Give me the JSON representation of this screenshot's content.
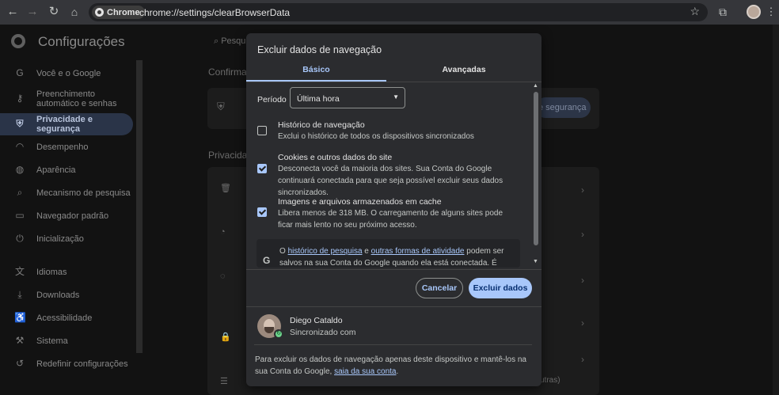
{
  "browser": {
    "chip_label": "Chrome",
    "url": "chrome://settings/clearBrowserData"
  },
  "settings": {
    "title": "Configurações",
    "search_placeholder": "Pesqu",
    "nav": [
      {
        "label": "Você e o Google",
        "icon": "google-icon"
      },
      {
        "label": "Preenchimento automático e senhas",
        "icon": "key-icon"
      },
      {
        "label": "Privacidade e segurança",
        "icon": "shield-icon",
        "active": true
      },
      {
        "label": "Desempenho",
        "icon": "gauge-icon"
      },
      {
        "label": "Aparência",
        "icon": "palette-icon"
      },
      {
        "label": "Mecanismo de pesquisa",
        "icon": "search-icon"
      },
      {
        "label": "Navegador padrão",
        "icon": "browser-icon"
      },
      {
        "label": "Inicialização",
        "icon": "power-icon"
      },
      {
        "label": "Idiomas",
        "icon": "translate-icon"
      },
      {
        "label": "Downloads",
        "icon": "download-icon"
      },
      {
        "label": "Acessibilidade",
        "icon": "accessibility-icon"
      },
      {
        "label": "Sistema",
        "icon": "wrench-icon"
      },
      {
        "label": "Redefinir configurações",
        "icon": "reset-icon"
      }
    ],
    "bg_section1": "Confirma",
    "bg_section2": "Privacida",
    "bg_button": "e segurança",
    "bg_truncated": "utras)"
  },
  "dialog": {
    "title": "Excluir dados de navegação",
    "tabs": [
      "Básico",
      "Avançadas"
    ],
    "period_label": "Período",
    "period_value": "Última hora",
    "options": [
      {
        "title": "Histórico de navegação",
        "desc": "Exclui o histórico de todos os dispositivos sincronizados",
        "checked": false
      },
      {
        "title": "Cookies e outros dados do site",
        "desc": "Desconecta você da maioria dos sites. Sua Conta do Google continuará conectada para que seja possível excluir seus dados sincronizados.",
        "checked": true
      },
      {
        "title": "Imagens e arquivos armazenados em cache",
        "desc": "Libera menos de 318 MB. O carregamento de alguns sites pode ficar mais lento no seu próximo acesso.",
        "checked": true
      }
    ],
    "info": {
      "prefix": "O ",
      "link1": "histórico de pesquisa",
      "middle": " e ",
      "link2": "outras formas de atividade",
      "suffix": " podem ser salvos na sua Conta do Google quando ela está conectada. É possível excluí-"
    },
    "cancel_label": "Cancelar",
    "delete_label": "Excluir dados",
    "user": {
      "name": "Diego Cataldo",
      "status": "Sincronizado com"
    },
    "footer": {
      "text": "Para excluir os dados de navegação apenas deste dispositivo e mantê-los na sua Conta do Google, ",
      "link": "saia da sua conta",
      "end": "."
    }
  }
}
